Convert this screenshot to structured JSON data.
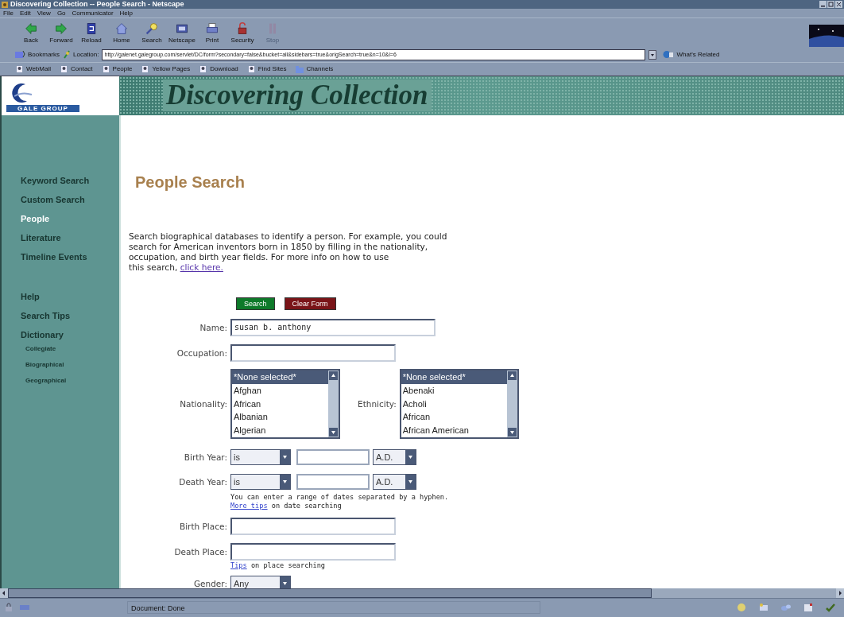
{
  "window": {
    "title": "Discovering Collection -- People Search - Netscape"
  },
  "menu": [
    "File",
    "Edit",
    "View",
    "Go",
    "Communicator",
    "Help"
  ],
  "toolbar": [
    {
      "label": "Back",
      "disabled": false
    },
    {
      "label": "Forward",
      "disabled": false
    },
    {
      "label": "Reload",
      "disabled": false
    },
    {
      "label": "Home",
      "disabled": false
    },
    {
      "label": "Search",
      "disabled": false
    },
    {
      "label": "Netscape",
      "disabled": false
    },
    {
      "label": "Print",
      "disabled": false
    },
    {
      "label": "Security",
      "disabled": false
    },
    {
      "label": "Stop",
      "disabled": true
    }
  ],
  "location_bar": {
    "bookmarks": "Bookmarks",
    "label": "Location:",
    "url": "http://galenet.galegroup.com/servlet/DC/form?secondary=false&bucket=all&sidebars=true&origSearch=true&n=10&l=6",
    "related": "What's Related"
  },
  "personal_toolbar": [
    "WebMail",
    "Contact",
    "People",
    "Yellow Pages",
    "Download",
    "Find Sites",
    "Channels"
  ],
  "site": {
    "logo_text": "GALE GROUP",
    "banner_title": "Discovering Collection"
  },
  "sidebar": {
    "groups": [
      {
        "items": [
          {
            "label": "Keyword Search",
            "selected": false
          },
          {
            "label": "Custom Search",
            "selected": false
          },
          {
            "label": "People",
            "selected": true
          },
          {
            "label": "Literature",
            "selected": false
          },
          {
            "label": "Timeline Events",
            "selected": false
          }
        ]
      },
      {
        "items": [
          {
            "label": "Help",
            "selected": false
          },
          {
            "label": "Search Tips",
            "selected": false
          },
          {
            "label": "Dictionary",
            "selected": false,
            "children": [
              {
                "label": "Collegiate",
                "selected": false
              },
              {
                "label": "Biographical",
                "selected": false
              },
              {
                "label": "Geographical",
                "selected": false
              }
            ]
          }
        ]
      }
    ]
  },
  "page": {
    "heading": "People Search",
    "intro_lines": [
      "Search biographical databases to identify a person. For example, you could",
      "search for American inventors born in 1850 by filling in the nationality,",
      "occupation, and birth year fields. For more info on how to use",
      "this search,"
    ],
    "intro_link": "click here.",
    "buttons": [
      {
        "label": "Search",
        "kind": "submit"
      },
      {
        "label": "Clear Form",
        "kind": "reset"
      }
    ],
    "fields": [
      {
        "kind": "text",
        "label": "Name:",
        "value": "susan b. anthony"
      },
      {
        "kind": "text",
        "label": "Occupation:"
      },
      {
        "kind": "lists",
        "lists": [
          {
            "label": "Nationality:",
            "options": [
              {
                "label": "*None selected*",
                "selected": true
              },
              {
                "label": "Afghan",
                "selected": false
              },
              {
                "label": "African",
                "selected": false
              },
              {
                "label": "Albanian",
                "selected": false
              },
              {
                "label": "Algerian",
                "selected": false
              }
            ]
          },
          {
            "label": "Ethnicity:",
            "options": [
              {
                "label": "*None selected*",
                "selected": true
              },
              {
                "label": "Abenaki",
                "selected": false
              },
              {
                "label": "Acholi",
                "selected": false
              },
              {
                "label": "African",
                "selected": false
              },
              {
                "label": "African American",
                "selected": false
              }
            ]
          }
        ]
      },
      {
        "kind": "year",
        "label": "Birth Year:",
        "operator": "is",
        "era": "A.D."
      },
      {
        "kind": "year",
        "label": "Death Year:",
        "operator": "is",
        "era": "A.D."
      },
      {
        "kind": "note",
        "text": "You can enter a range of dates separated by a hyphen."
      },
      {
        "kind": "note",
        "link": "More tips",
        "suffix": "on date searching"
      },
      {
        "kind": "text",
        "label": "Birth Place:"
      },
      {
        "kind": "text",
        "label": "Death Place:"
      },
      {
        "kind": "note",
        "link": "Tips",
        "suffix": "on place searching"
      },
      {
        "kind": "select",
        "label": "Gender:",
        "value": "Any"
      }
    ]
  },
  "status_bar": {
    "text": "Document: Done"
  }
}
